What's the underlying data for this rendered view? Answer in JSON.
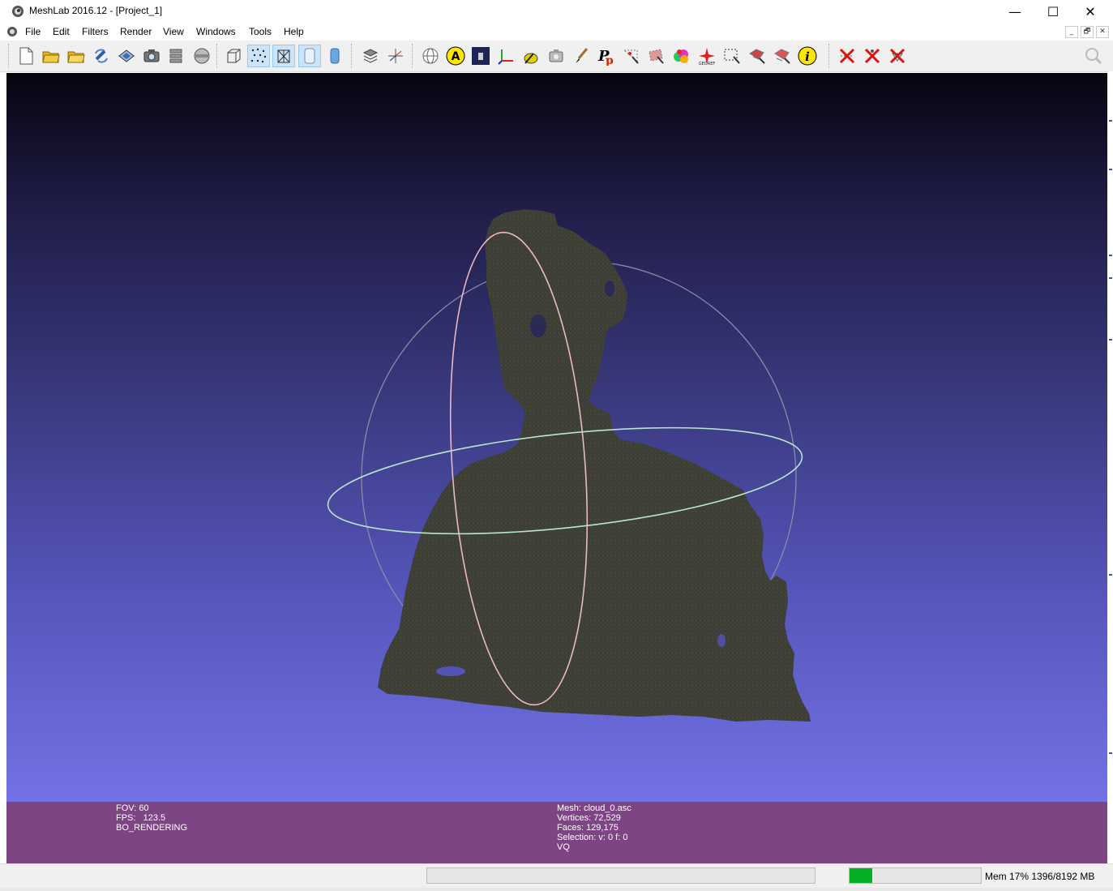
{
  "window": {
    "title": "MeshLab 2016.12 - [Project_1]",
    "minimize_glyph": "—",
    "maximize_glyph": "☐",
    "close_glyph": "✕"
  },
  "menu": {
    "items": [
      "File",
      "Edit",
      "Filters",
      "Render",
      "View",
      "Windows",
      "Tools",
      "Help"
    ],
    "mdi_controls": [
      "_",
      "🗗",
      "✕"
    ]
  },
  "toolbar": {
    "groups": [
      [
        "new-document",
        "open-project",
        "open-folder",
        "reload",
        "save-snapshot",
        "camera-snapshot",
        "layers",
        "render-mode"
      ],
      [
        "bounding-box",
        "points",
        "wireframe",
        "flat-lines",
        "smooth"
      ],
      [
        "layer-stack",
        "axis-trackball"
      ],
      [
        "sphere-texture",
        "annotate-a",
        "gradient-box",
        "axes",
        "pick-tool",
        "align",
        "paint-brush",
        "pp-tool",
        "select-vertices",
        "select-faces",
        "color-paint",
        "georef",
        "rect-select",
        "select-connected",
        "select-region",
        "info"
      ],
      [
        "delete-faces",
        "delete-vertices",
        "delete-selected"
      ]
    ],
    "search_icon": "magnifier-icon",
    "active": [
      "points",
      "wireframe",
      "flat-lines"
    ]
  },
  "info_panel": {
    "left": {
      "fov": "FOV: 60",
      "fps": "FPS:   123.5",
      "mode": "BO_RENDERING"
    },
    "center": {
      "mesh": "Mesh: cloud_0.asc",
      "vertices": "Vertices: 72,529",
      "faces": "Faces: 129,175",
      "selection": "Selection: v: 0 f: 0",
      "vq": "VQ"
    }
  },
  "status": {
    "memory_label": "Mem 17% 1396/8192 MB",
    "memory_fraction": 0.17
  },
  "colors": {
    "info_panel_bg": "#7d4583",
    "point_cloud": "#3e3e39",
    "memory_fill": "#06b025"
  }
}
